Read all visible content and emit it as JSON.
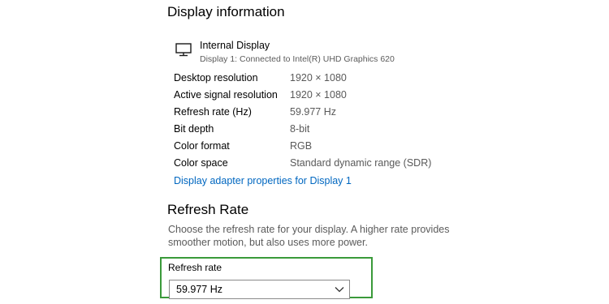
{
  "display_information": {
    "title": "Display information",
    "display_name": "Internal Display",
    "display_sub": "Display 1: Connected to Intel(R) UHD Graphics 620",
    "rows": [
      {
        "label": "Desktop resolution",
        "value": "1920 × 1080"
      },
      {
        "label": "Active signal resolution",
        "value": "1920 × 1080"
      },
      {
        "label": "Refresh rate (Hz)",
        "value": "59.977 Hz"
      },
      {
        "label": "Bit depth",
        "value": "8-bit"
      },
      {
        "label": "Color format",
        "value": "RGB"
      },
      {
        "label": "Color space",
        "value": "Standard dynamic range (SDR)"
      }
    ],
    "adapter_link": "Display adapter properties for Display 1"
  },
  "refresh_rate": {
    "title": "Refresh Rate",
    "description": "Choose the refresh rate for your display. A higher rate provides smoother motion, but also uses more power.",
    "select_label": "Refresh rate",
    "selected_value": "59.977 Hz"
  },
  "colors": {
    "link": "#0067c0",
    "highlight": "#3a9a3a",
    "secondary_text": "#5b5b5b"
  },
  "icons": {
    "display": "monitor-icon",
    "dropdown": "chevron-down-icon"
  }
}
